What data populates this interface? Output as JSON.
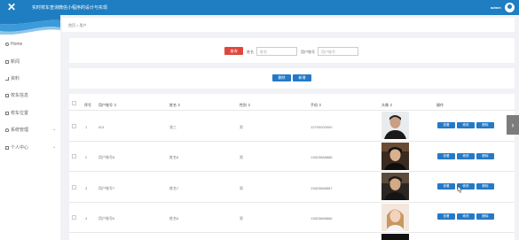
{
  "header": {
    "app_title": "实时校车查询微信小程序的设计与实现",
    "user_name": "admin",
    "close_icon": "close-icon",
    "avatar_icon": "user-avatar-icon"
  },
  "sidebar": {
    "items": [
      {
        "label": "Home",
        "icon": "home-icon"
      },
      {
        "label": "新闻",
        "icon": "grid-icon"
      },
      {
        "label": "资料",
        "icon": "chart-icon"
      },
      {
        "label": "校车信息",
        "icon": "grid-icon"
      },
      {
        "label": "校车位置",
        "icon": "square-icon"
      },
      {
        "label": "系统管理",
        "icon": "user-icon",
        "expandable": true
      },
      {
        "label": "个人中心",
        "icon": "card-icon",
        "expandable": true
      }
    ]
  },
  "breadcrumb": "首页 > 用户",
  "search": {
    "button_label": "查询",
    "name_label": "姓名",
    "name_placeholder": "姓名",
    "account_label": "用户账号",
    "account_placeholder": "用户账号"
  },
  "actions": {
    "delete_label": "删除",
    "add_label": "新增"
  },
  "table": {
    "headers": [
      "序号",
      "用户账号 ⇕",
      "姓名 ⇕",
      "性别 ⇕",
      "手机 ⇕",
      "头像 ⇕",
      "操作"
    ],
    "rows": [
      {
        "index": "1",
        "account": "001",
        "name": "张三",
        "gender": "男",
        "phone": "13700000000"
      },
      {
        "index": "2",
        "account": "用户账号8",
        "name": "姓名8",
        "gender": "男",
        "phone": "13823888888"
      },
      {
        "index": "3",
        "account": "用户账号7",
        "name": "姓名7",
        "gender": "男",
        "phone": "13823888887"
      },
      {
        "index": "4",
        "account": "用户账号6",
        "name": "姓名6",
        "gender": "男",
        "phone": "13823888886"
      }
    ],
    "op_labels": {
      "view": "查看",
      "edit": "修改",
      "delete": "删除"
    }
  },
  "colors": {
    "header_blue": "#1f7dc1",
    "button_blue": "#2579c6",
    "search_red": "#e0473b"
  },
  "icons": {
    "next_arrow": "chevron-right-icon",
    "expand_arrow": "chevron-down-icon"
  }
}
